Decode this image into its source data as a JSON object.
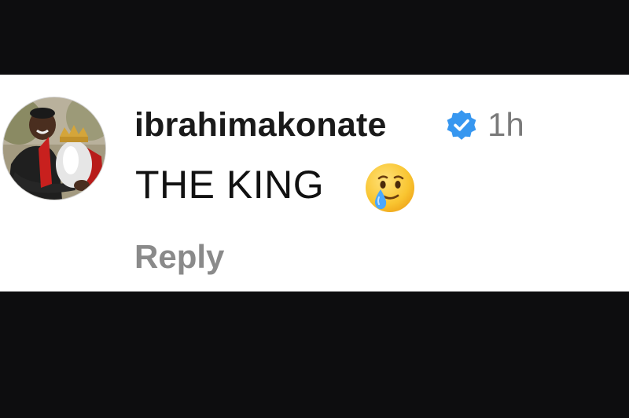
{
  "comment": {
    "username": "ibrahimakonate",
    "timestamp": "1h",
    "text": "THE KING",
    "emoji": "face-holding-back-tears",
    "reply_label": "Reply",
    "verified": true
  },
  "colors": {
    "background": "#0d0d0f",
    "card": "#ffffff",
    "verified_badge": "#3797f0",
    "secondary_text": "#8a8a8a"
  }
}
